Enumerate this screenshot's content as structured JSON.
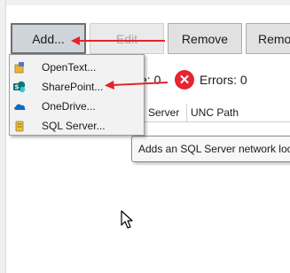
{
  "toolbar": {
    "add_label": "Add...",
    "edit_label": "Edit",
    "remove_label": "Remove",
    "remove_other_label": "Remo"
  },
  "status": {
    "warnings_partial": "e: 0",
    "errors_label": "Errors: 0"
  },
  "grid": {
    "columns": [
      "Server",
      "UNC Path"
    ]
  },
  "tooltip": {
    "text": "Adds an SQL Server network loc"
  },
  "add_menu": {
    "items": [
      {
        "label": "OpenText...",
        "icon": "opentext-icon"
      },
      {
        "label": "SharePoint...",
        "icon": "sharepoint-icon"
      },
      {
        "label": "OneDrive...",
        "icon": "onedrive-icon"
      },
      {
        "label": "SQL Server...",
        "icon": "sql-server-icon"
      }
    ]
  },
  "colors": {
    "annotation_arrow": "#e0262b",
    "error_icon": "#e5252f",
    "sharepoint": "#036c70",
    "onedrive": "#0f6cbd"
  }
}
